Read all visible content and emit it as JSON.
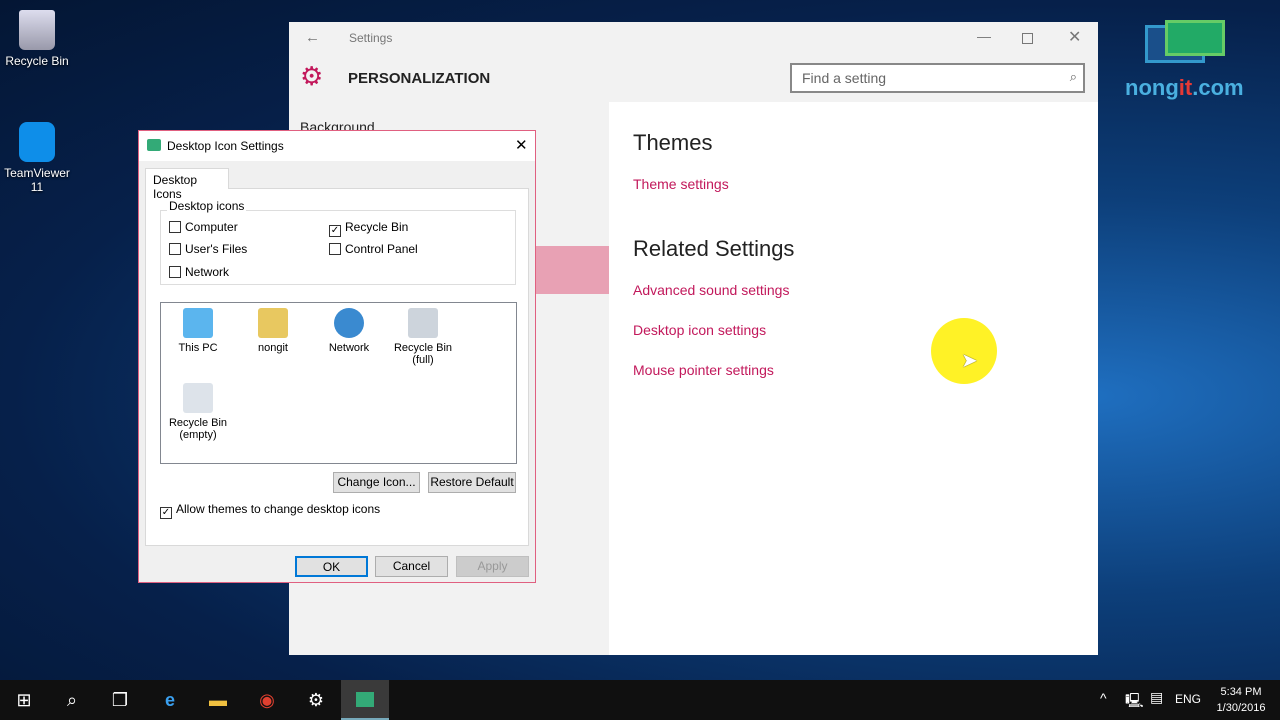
{
  "desktop": {
    "icons": [
      {
        "label": "Recycle Bin"
      },
      {
        "label": "TeamViewer 11"
      }
    ],
    "logo_text": "nongit.com"
  },
  "settings": {
    "title": "Settings",
    "section": "PERSONALIZATION",
    "search_placeholder": "Find a setting",
    "nav_first": "Background",
    "themes_heading": "Themes",
    "theme_settings": "Theme settings",
    "related_heading": "Related Settings",
    "related_links": [
      "Advanced sound settings",
      "Desktop icon settings",
      "Mouse pointer settings"
    ],
    "accent": "#c2185b"
  },
  "dialog": {
    "title": "Desktop Icon Settings",
    "tab": "Desktop Icons",
    "group": "Desktop icons",
    "checkboxes": [
      {
        "label": "Computer",
        "checked": false
      },
      {
        "label": "User's Files",
        "checked": false
      },
      {
        "label": "Network",
        "checked": false
      },
      {
        "label": "Recycle Bin",
        "checked": true
      },
      {
        "label": "Control Panel",
        "checked": false
      }
    ],
    "icons": [
      "This PC",
      "nongit",
      "Network",
      "Recycle Bin (full)",
      "Recycle Bin (empty)"
    ],
    "change_icon": "Change Icon...",
    "restore_default": "Restore Default",
    "allow_themes": "Allow themes to change desktop icons",
    "allow_themes_checked": true,
    "ok": "OK",
    "cancel": "Cancel",
    "apply": "Apply"
  },
  "taskbar": {
    "lang": "ENG",
    "time": "5:34 PM",
    "date": "1/30/2016"
  }
}
